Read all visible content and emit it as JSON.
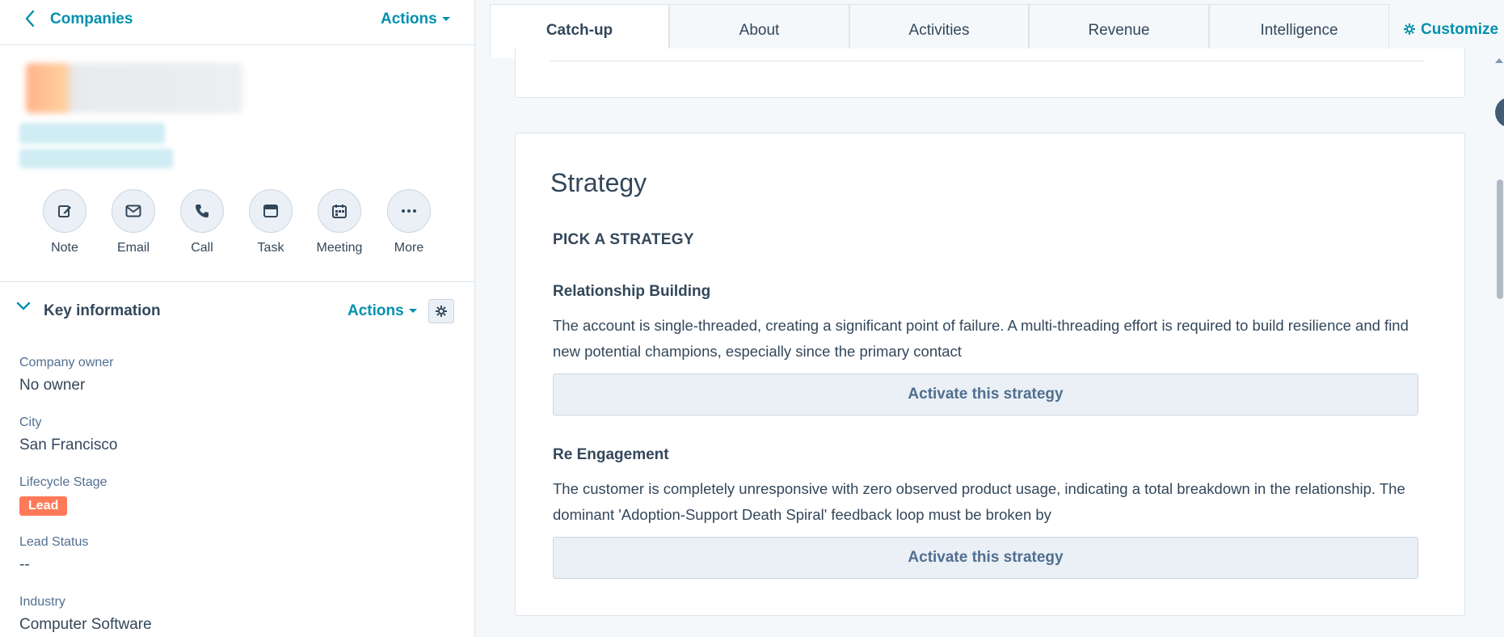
{
  "header": {
    "back_label": "Companies",
    "actions_label": "Actions"
  },
  "quick_actions": [
    {
      "label": "Note",
      "icon": "note-edit-icon"
    },
    {
      "label": "Email",
      "icon": "email-icon"
    },
    {
      "label": "Call",
      "icon": "phone-icon"
    },
    {
      "label": "Task",
      "icon": "task-icon"
    },
    {
      "label": "Meeting",
      "icon": "calendar-icon"
    },
    {
      "label": "More",
      "icon": "more-dots-icon"
    }
  ],
  "key_info": {
    "title": "Key information",
    "actions_label": "Actions",
    "properties": [
      {
        "label": "Company owner",
        "value": "No owner"
      },
      {
        "label": "City",
        "value": "San Francisco"
      },
      {
        "label": "Lifecycle Stage",
        "value": "Lead"
      },
      {
        "label": "Lead Status",
        "value": "--"
      },
      {
        "label": "Industry",
        "value": "Computer Software"
      }
    ]
  },
  "tabs": [
    {
      "label": "Catch-up",
      "active": true
    },
    {
      "label": "About",
      "active": false
    },
    {
      "label": "Activities",
      "active": false
    },
    {
      "label": "Revenue",
      "active": false
    },
    {
      "label": "Intelligence",
      "active": false
    }
  ],
  "customize_label": "Customize",
  "strategy": {
    "title": "Strategy",
    "pick_label": "PICK A STRATEGY",
    "items": [
      {
        "heading": "Relationship Building",
        "description": "The account is single-threaded, creating a significant point of failure. A multi-threading effort is required to build resilience and find new potential champions, especially since the primary contact",
        "button_label": "Activate this strategy"
      },
      {
        "heading": "Re Engagement",
        "description": "The customer is completely unresponsive with zero observed product usage, indicating a total breakdown in the relationship. The dominant 'Adoption-Support Death Spiral' feedback loop must be broken by",
        "button_label": "Activate this strategy"
      }
    ]
  },
  "colors": {
    "accent": "#0091ae",
    "text": "#33475b",
    "lead_badge": "#ff7a59"
  }
}
